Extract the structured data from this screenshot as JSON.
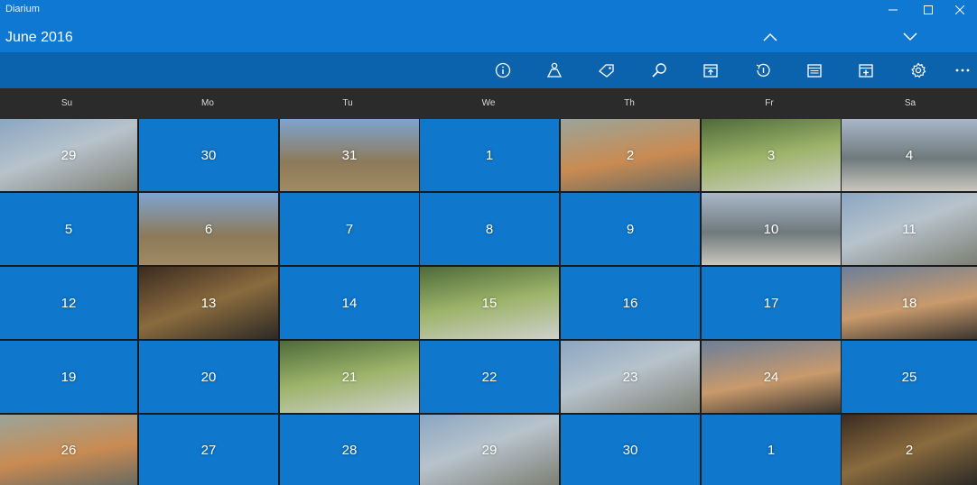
{
  "window": {
    "app_title": "Diarium",
    "controls": {
      "minimize": "minimize-icon",
      "maximize": "maximize-icon",
      "close": "close-icon"
    }
  },
  "header": {
    "month_title": "June 2016",
    "prev_icon": "chevron-up-icon",
    "next_icon": "chevron-down-icon"
  },
  "toolbar": {
    "buttons": [
      "info-icon",
      "person-icon",
      "tag-icon",
      "search-icon",
      "calendar-today-icon",
      "history-icon",
      "calendar-list-icon",
      "calendar-add-icon",
      "gear-icon",
      "more-icon"
    ]
  },
  "weekdays": [
    "Su",
    "Mo",
    "Tu",
    "We",
    "Th",
    "Fr",
    "Sa"
  ],
  "weeks": [
    [
      "29",
      "30",
      "31",
      "1",
      "2",
      "3",
      "4"
    ],
    [
      "5",
      "6",
      "7",
      "8",
      "9",
      "10",
      "11"
    ],
    [
      "12",
      "13",
      "14",
      "15",
      "16",
      "17",
      "18"
    ],
    [
      "19",
      "20",
      "21",
      "22",
      "23",
      "24",
      "25"
    ],
    [
      "26",
      "27",
      "28",
      "29",
      "30",
      "1",
      "2"
    ]
  ],
  "photo_days": {
    "0": [
      0,
      2,
      4,
      5,
      6
    ],
    "1": [
      1,
      5,
      6
    ],
    "2": [
      1,
      3,
      6
    ],
    "3": [
      2,
      4,
      5
    ],
    "4": [
      0,
      3,
      6
    ]
  },
  "colors": {
    "accent": "#0f77cc",
    "toolbar": "#0b63ad",
    "weekday_bar": "#2b2b2b"
  }
}
